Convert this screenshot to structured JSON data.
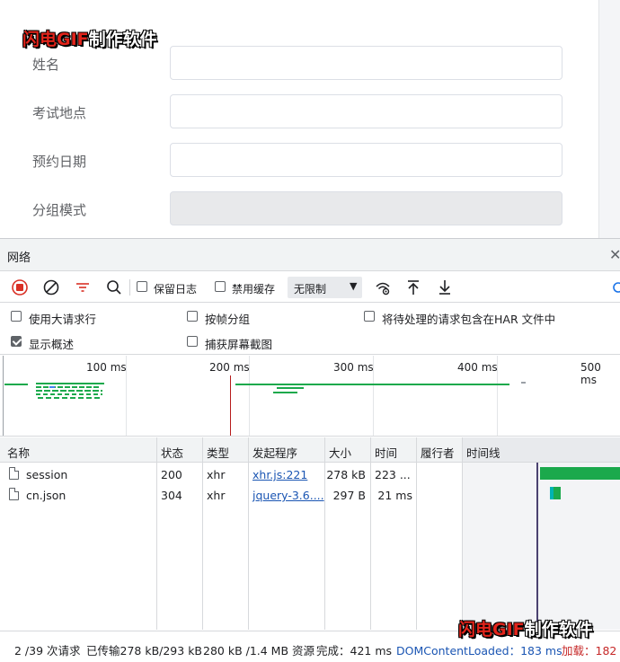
{
  "watermark": {
    "part1": "闪电GIF",
    "part2": "制作软件"
  },
  "form": {
    "fields": [
      {
        "label": "姓名",
        "value": ""
      },
      {
        "label": "考试地点",
        "value": ""
      },
      {
        "label": "预约日期",
        "value": ""
      },
      {
        "label": "分组模式",
        "value": ""
      }
    ]
  },
  "devtools": {
    "title": "网络",
    "close": "✕",
    "toolbar": {
      "preserve_log": "保留日志",
      "disable_cache": "禁用缓存",
      "throttle": "无限制",
      "throttle_arrow": "▼"
    },
    "options": {
      "big_rows": "使用大请求行",
      "group_by_frame": "按帧分组",
      "har_pending": "将待处理的请求包含在HAR 文件中",
      "show_overview": "显示概述",
      "capture_screenshots": "捕获屏幕截图"
    },
    "overview_ticks": [
      "100 ms",
      "200 ms",
      "300 ms",
      "400 ms",
      "500 ms"
    ],
    "columns": {
      "name": "名称",
      "status": "状态",
      "type": "类型",
      "initiator": "发起程序",
      "size": "大小",
      "time": "时间",
      "fulfilled_by": "履行者",
      "waterfall": "时间线"
    },
    "rows": [
      {
        "name": "session",
        "status": "200",
        "type": "xhr",
        "initiator": "xhr.js:221",
        "size": "278 kB",
        "time": "223 ..."
      },
      {
        "name": "cn.json",
        "status": "304",
        "type": "xhr",
        "initiator": "jquery-3.6....",
        "size": "297 B",
        "time": "21 ms"
      }
    ],
    "status_bar": {
      "requests": "2 /39 次请求",
      "transferred": "已传输278 kB/293 kB",
      "resources": "280 kB /1.4 MB 资源",
      "finish": "完成：421 ms",
      "dom_loaded": "DOMContentLoaded：183 ms",
      "load": "加载：182"
    }
  },
  "colors": {
    "accent_green": "#1ba94c",
    "record_red": "#d93025",
    "link_blue": "#1a55b3"
  }
}
